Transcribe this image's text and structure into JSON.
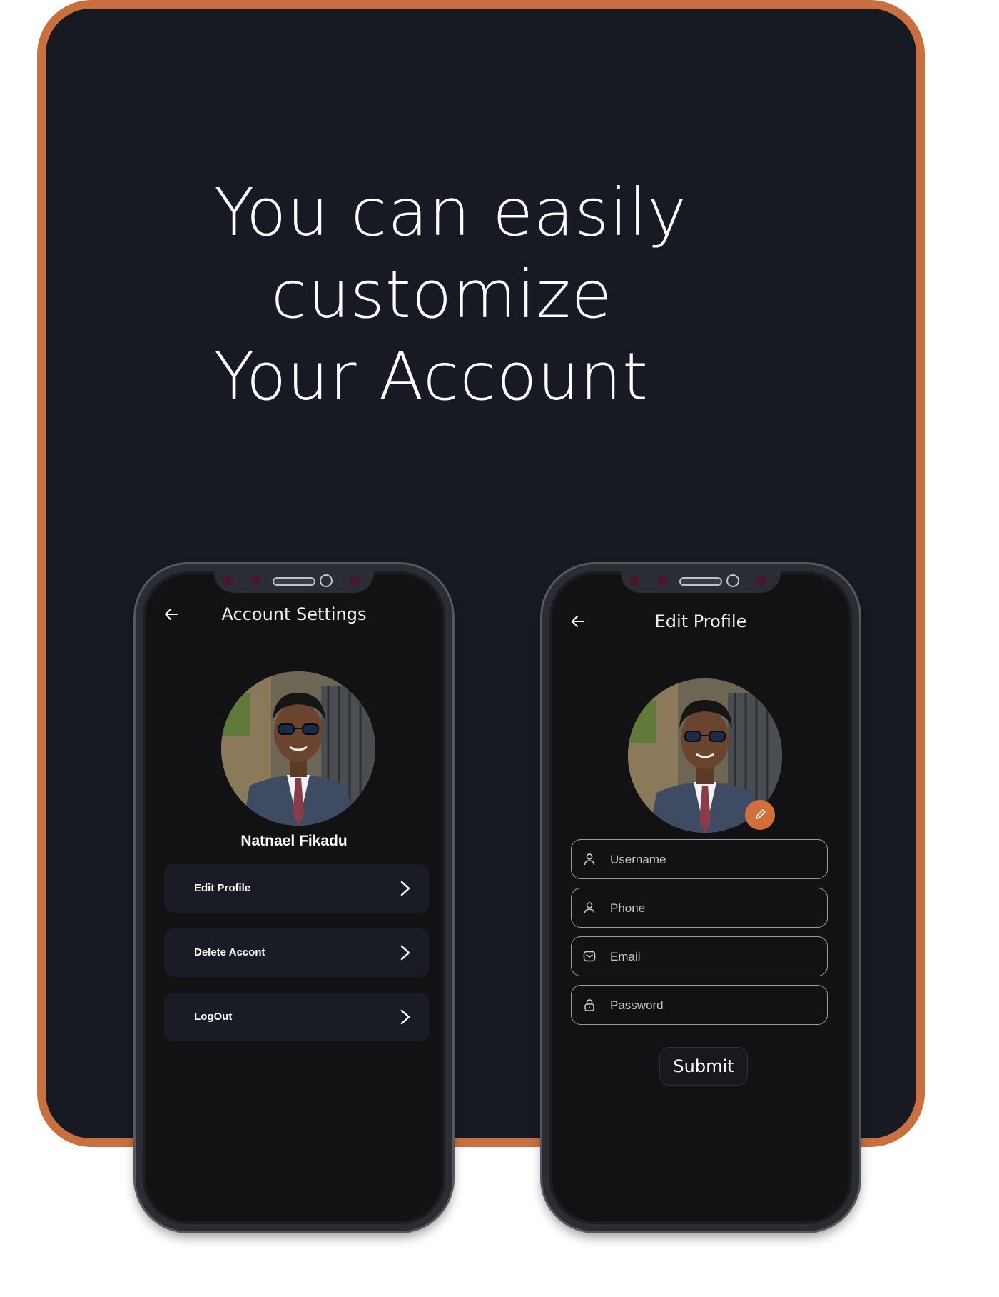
{
  "colors": {
    "accent": "#c8703f",
    "card_background": "#171a23",
    "phone_screen": "#121215"
  },
  "headline": {
    "line1": "You can easily",
    "line2": "customize",
    "line3": "Your Account"
  },
  "account_settings": {
    "title": "Account Settings",
    "back_icon": "arrow-left-icon",
    "user_name": "Natnael Fikadu",
    "menu": [
      {
        "label": "Edit Profile",
        "icon": "chevron-right-icon"
      },
      {
        "label": "Delete Accont",
        "icon": "chevron-right-icon"
      },
      {
        "label": "LogOut",
        "icon": "chevron-right-icon"
      }
    ]
  },
  "edit_profile": {
    "title": "Edit Profile",
    "back_icon": "arrow-left-icon",
    "edit_icon": "pencil-icon",
    "fields": [
      {
        "placeholder": "Username",
        "icon": "user-icon"
      },
      {
        "placeholder": "Phone",
        "icon": "user-icon"
      },
      {
        "placeholder": "Email",
        "icon": "mail-icon"
      },
      {
        "placeholder": "Password",
        "icon": "lock-icon"
      }
    ],
    "submit_label": "Submit"
  }
}
